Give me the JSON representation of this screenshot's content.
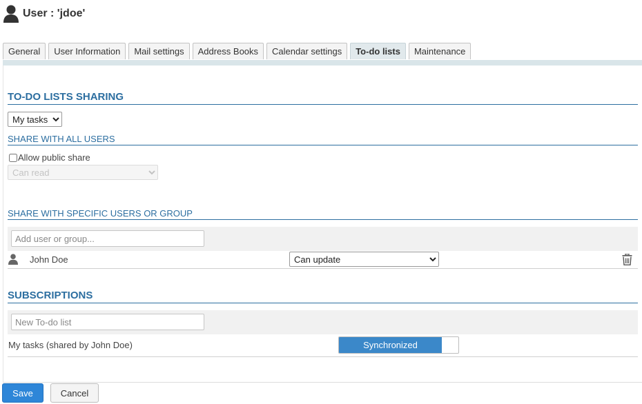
{
  "title": "User : 'jdoe'",
  "tabs": [
    {
      "label": "General",
      "active": false
    },
    {
      "label": "User Information",
      "active": false
    },
    {
      "label": "Mail settings",
      "active": false
    },
    {
      "label": "Address Books",
      "active": false
    },
    {
      "label": "Calendar settings",
      "active": false
    },
    {
      "label": "To-do lists",
      "active": true
    },
    {
      "label": "Maintenance",
      "active": false
    }
  ],
  "sharing": {
    "title": "TO-DO LISTS SHARING",
    "list_select": {
      "value": "My tasks"
    },
    "all_users": {
      "title": "SHARE WITH ALL USERS",
      "allow_public_label": "Allow public share",
      "allow_public_checked": false,
      "permission": {
        "value": "Can read",
        "disabled": true
      }
    },
    "specific": {
      "title": "SHARE WITH SPECIFIC USERS OR GROUP",
      "add_placeholder": "Add user or group...",
      "entries": [
        {
          "name": "John Doe",
          "permission": "Can update"
        }
      ]
    }
  },
  "subscriptions": {
    "title": "SUBSCRIPTIONS",
    "new_placeholder": "New To-do list",
    "items": [
      {
        "name": "My tasks (shared by John Doe)",
        "status": "Synchronized",
        "synchronized": true
      }
    ]
  },
  "buttons": {
    "save": "Save",
    "cancel": "Cancel"
  },
  "icons": {
    "user": "user-icon",
    "trash": "trash-icon",
    "chevron": "chevron-down-icon"
  },
  "colors": {
    "section_title": "#2c6ea0",
    "active_tab": "#e1e9ec",
    "toggle_on": "#3b88c9",
    "save_button": "#2e86d8"
  }
}
